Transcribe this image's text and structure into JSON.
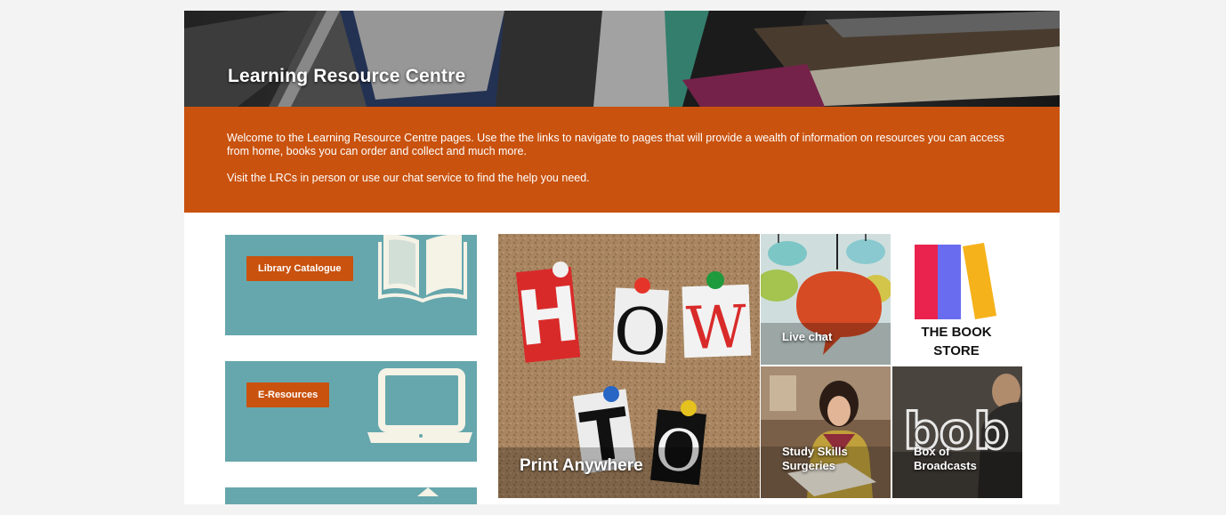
{
  "banner": {
    "title": "Learning Resource Centre"
  },
  "welcome": {
    "paragraph1": "Welcome to the Learning Resource Centre pages.  Use the the links to navigate to pages that will provide a wealth of information on resources you can access from home, books you can order and collect and much more.",
    "paragraph2": "Visit the LRCs in person or use our chat service to find the help you need."
  },
  "tiles": [
    {
      "label": "Library Catalogue",
      "icon": "open-book-icon"
    },
    {
      "label": "E-Resources",
      "icon": "laptop-icon"
    }
  ],
  "grid": {
    "print_anywhere": {
      "label": "Print Anywhere",
      "letters": [
        "H",
        "O",
        "W",
        "T",
        "O"
      ]
    },
    "live_chat": {
      "label": "Live chat"
    },
    "book_store": {
      "line1": "THE BOOK",
      "line2": "STORE"
    },
    "study_skills": {
      "label": "Study Skills Surgeries"
    },
    "bob": {
      "label": "Box of Broadcasts",
      "logo_text": "bob"
    }
  },
  "colors": {
    "accent": "#c9520e",
    "teal": "#66a7ad",
    "background": "#f3f3f3"
  }
}
